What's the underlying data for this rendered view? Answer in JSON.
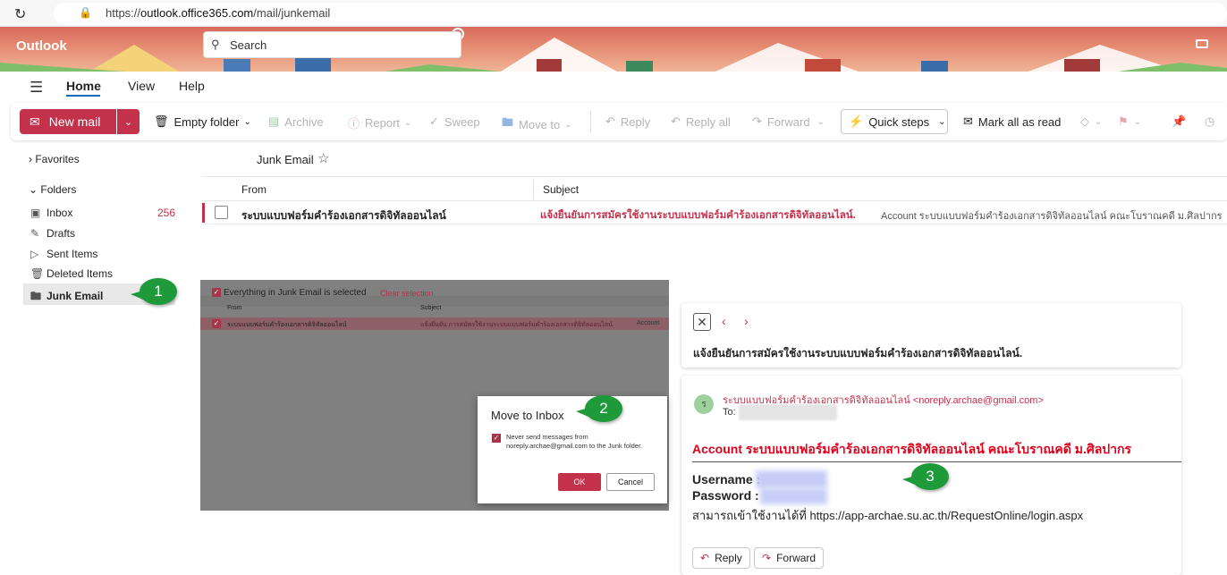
{
  "browser": {
    "url_prefix": "https://",
    "url_host": "outlook.office365.com",
    "url_path": "/mail/junkemail"
  },
  "header": {
    "app_name": "Outlook",
    "search_placeholder": "Search"
  },
  "menu": {
    "tabs": [
      "Home",
      "View",
      "Help"
    ]
  },
  "toolbar": {
    "new_mail": "New mail",
    "empty_folder": "Empty folder",
    "archive": "Archive",
    "report": "Report",
    "sweep": "Sweep",
    "move_to": "Move to",
    "reply": "Reply",
    "reply_all": "Reply all",
    "forward": "Forward",
    "quick_steps": "Quick steps",
    "mark_all_read": "Mark all as read"
  },
  "sidebar": {
    "favorites": "Favorites",
    "folders": "Folders",
    "items": [
      {
        "label": "Inbox",
        "icon": "inbox-icon",
        "count": "256"
      },
      {
        "label": "Drafts",
        "icon": "pencil-icon"
      },
      {
        "label": "Sent Items",
        "icon": "send-icon"
      },
      {
        "label": "Deleted Items",
        "icon": "trash-icon"
      },
      {
        "label": "Junk Email",
        "icon": "junk-folder-icon"
      }
    ]
  },
  "list": {
    "title": "Junk Email",
    "col_from": "From",
    "col_subject": "Subject",
    "row": {
      "from": "ระบบแบบฟอร์มคำร้องเอกสารดิจิทัลออนไลน์",
      "subject": "แจ้งยืนยันการสมัครใช้งานระบบแบบฟอร์มคำร้องเอกสารดิจิทัลออนไลน์.",
      "preview": "Account ระบบแบบฟอร์มคำร้องเอกสารดิจิทัลออนไลน์ คณะโบราณคดี ม.ศิลปากร"
    }
  },
  "inset": {
    "selection_text": "Everything in Junk Email is selected",
    "clear": "Clear selection",
    "col_from": "From",
    "col_subject": "Subject",
    "row_from": "ระบบแบบฟอร์มคำร้องเอกสารดิจิทัลออนไลน์",
    "row_subject": "แจ้งยืนยัน การสมัครใช้งานระบบแบบฟอร์มคำร้องเอกสารดิจิทัลออนไลน์.",
    "row_preview": "Account"
  },
  "dialog": {
    "title": "Move to Inbox",
    "checkbox_text": "Never send messages from noreply.archae@gmail.com to the Junk folder.",
    "ok": "OK",
    "cancel": "Cancel"
  },
  "reading": {
    "subject": "แจ้งยืนยันการสมัครใช้งานระบบแบบฟอร์มคำร้องเอกสารดิจิทัลออนไลน์.",
    "avatar_letter": "ร",
    "sender": "ระบบแบบฟอร์มคำร้องเอกสารดิจิทัลออนไลน์ <noreply.archae@gmail.com>",
    "to_label": "To:",
    "body_title": "Account ระบบแบบฟอร์มคำร้องเอกสารดิจิทัลออนไลน์ คณะโบราณคดี ม.ศิลปากร",
    "username_label": "Username :",
    "password_label": "Password :",
    "access_line": "สามารถเข้าใช้งานได้ที่ https://app-archae.su.ac.th/RequestOnline/login.aspx",
    "reply": "Reply",
    "forward": "Forward"
  },
  "callouts": [
    "1",
    "2",
    "3"
  ],
  "colors": {
    "accent": "#c4314b",
    "callout": "#1f9a3a",
    "title_red": "#e0001b"
  }
}
